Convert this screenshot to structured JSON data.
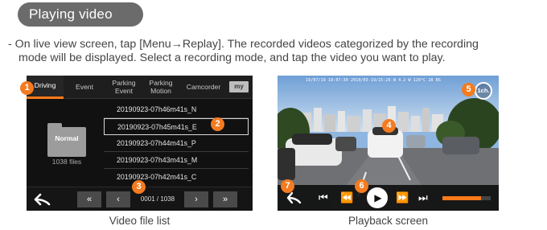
{
  "section": {
    "title": "Playing video"
  },
  "description": {
    "line1": "- On live view screen, tap [Menu→Replay]. The recorded videos categorized by the recording",
    "line2": "mode will be displayed. Select a recording mode, and tap the video you want to play."
  },
  "file_list": {
    "tabs": [
      {
        "label": "Driving",
        "active": true
      },
      {
        "label": "Event",
        "active": false
      },
      {
        "label": "Parking\nEvent",
        "active": false
      },
      {
        "label": "Parking\nMotion",
        "active": false
      },
      {
        "label": "Camcorder",
        "active": false
      },
      {
        "label": "my",
        "active": false
      }
    ],
    "folder": {
      "label": "Normal",
      "count": "1038 files"
    },
    "files": [
      "20190923-07h46m41s_N",
      "20190923-07h45m41s_E",
      "20190923-07h44m41s_P",
      "20190923-07h43m41s_M",
      "20190923-07h42m41s_C"
    ],
    "selected_index": 1,
    "page_indicator": "0001 / 1038",
    "nav": {
      "back": "back-arrow",
      "first": "«",
      "prev": "‹",
      "next": "›",
      "last": "»"
    }
  },
  "playback": {
    "osd": "19/07/19 18:07:30   2019/03-19/15:26  N 4.2 W 120°C 28 BS",
    "channel": "1ch.",
    "progress": 0.8,
    "controls": {
      "back": "back-arrow-icon",
      "skip_start": "skip-start-icon",
      "rewind": "rewind-icon",
      "play": "play-icon",
      "fast_forward": "fast-forward-icon",
      "skip_end": "skip-end-icon"
    }
  },
  "captions": {
    "list": "Video file list",
    "playback": "Playback screen"
  },
  "markers": [
    "1",
    "2",
    "3",
    "4",
    "5",
    "6",
    "7"
  ],
  "colors": {
    "accent": "#f47b20",
    "pill": "#6b6b6b",
    "panel": "#111111"
  }
}
